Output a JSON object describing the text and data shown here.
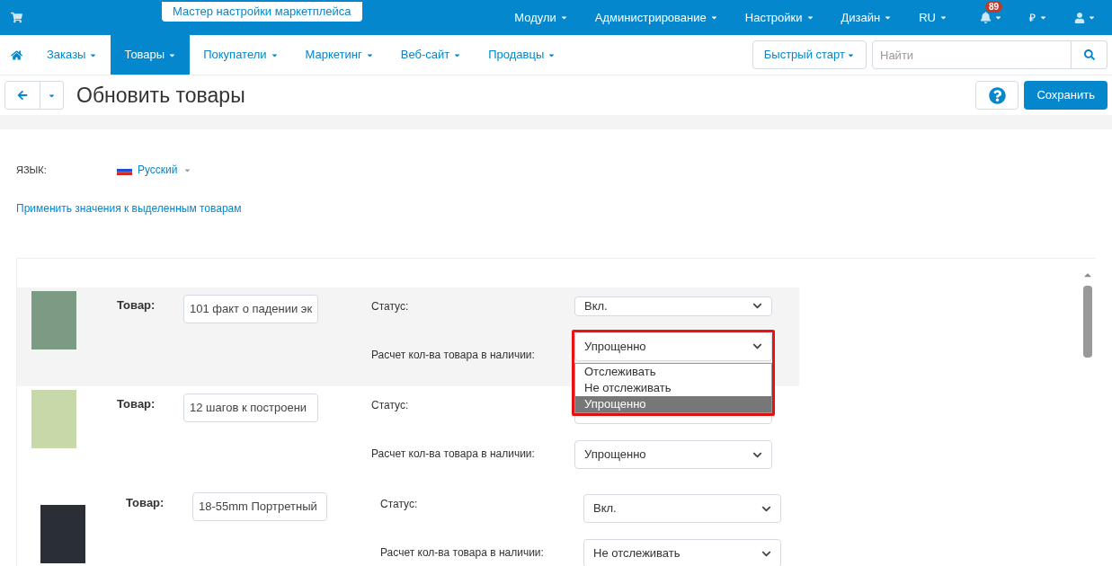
{
  "top_bar": {
    "wizard_button": "Мастер настройки маркетплейса",
    "menus": [
      {
        "label": "Модули"
      },
      {
        "label": "Администрирование"
      },
      {
        "label": "Настройки"
      },
      {
        "label": "Дизайн"
      },
      {
        "label": "RU"
      }
    ],
    "notifications_count": "89",
    "currency": "₽"
  },
  "nav": {
    "items": [
      {
        "label": "Заказы",
        "selected": false
      },
      {
        "label": "Товары",
        "selected": true
      },
      {
        "label": "Покупатели",
        "selected": false
      },
      {
        "label": "Маркетинг",
        "selected": false
      },
      {
        "label": "Веб-сайт",
        "selected": false
      },
      {
        "label": "Продавцы",
        "selected": false
      }
    ],
    "quick_start": "Быстрый старт",
    "search_placeholder": "Найти"
  },
  "toolbar": {
    "title": "Обновить товары",
    "save_button": "Сохранить"
  },
  "language": {
    "label": "ЯЗЫК:",
    "value": "Русский"
  },
  "apply_link": "Применить значения к выделенным товарам",
  "products": [
    {
      "name_label": "Товар:",
      "name_value": "101 факт о падении эк",
      "status_label": "Статус:",
      "status_value": "Вкл.",
      "stock_label": "Расчет кол-ва товара в наличии:",
      "stock_value": "Упрощенно",
      "dropdown_open": true
    },
    {
      "name_label": "Товар:",
      "name_value": "12 шагов к построени",
      "status_label": "Статус:",
      "stock_label": "Расчет кол-ва товара в наличии:",
      "stock_value": "Упрощенно",
      "dropdown_open": false
    },
    {
      "name_label": "Товар:",
      "name_value": "18-55mm Портретный",
      "status_label": "Статус:",
      "status_value": "Вкл.",
      "stock_label": "Расчет кол-ва товара в наличии:",
      "stock_value": "Не отслеживать",
      "dropdown_open": false
    }
  ],
  "dropdown_options": [
    {
      "label": "Отслеживать",
      "selected": false
    },
    {
      "label": "Не отслеживать",
      "selected": false
    },
    {
      "label": "Упрощенно",
      "selected": true
    }
  ]
}
